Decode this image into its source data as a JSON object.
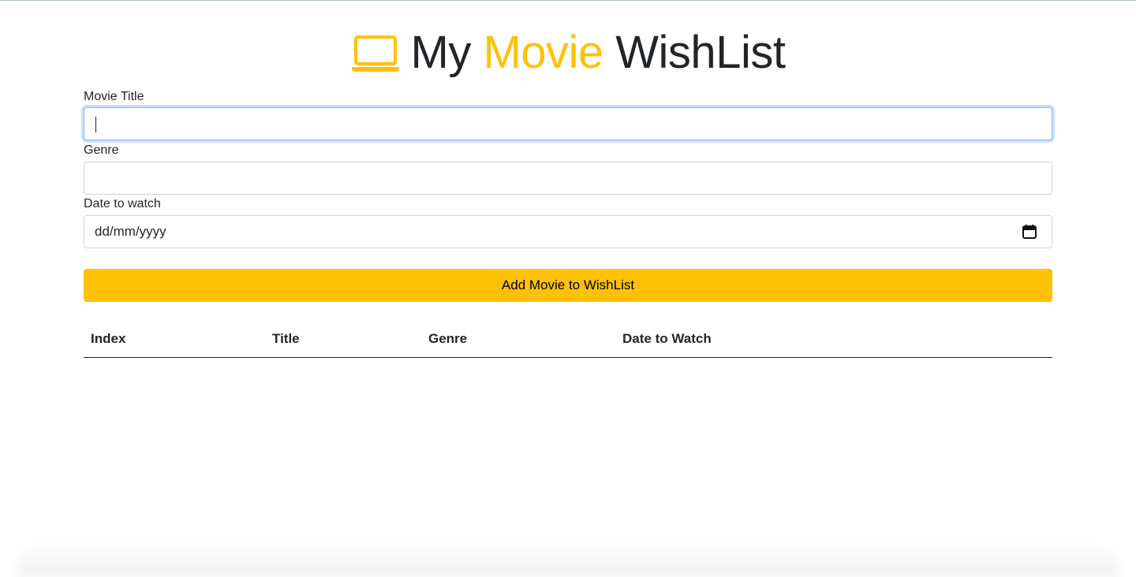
{
  "heading": {
    "part1": "My ",
    "part2": "Movie",
    "part3": " WishList",
    "icon": "laptop-icon",
    "accent_color": "#ffc107"
  },
  "form": {
    "title_label": "Movie Title",
    "title_value": "",
    "genre_label": "Genre",
    "genre_value": "",
    "date_label": "Date to watch",
    "date_placeholder": "dd/mm/yyyy",
    "date_icon": "calendar-icon",
    "submit_label": "Add Movie to WishList",
    "submit_color": "#ffc107"
  },
  "table": {
    "columns": [
      "Index",
      "Title",
      "Genre",
      "Date to Watch"
    ],
    "rows": []
  }
}
